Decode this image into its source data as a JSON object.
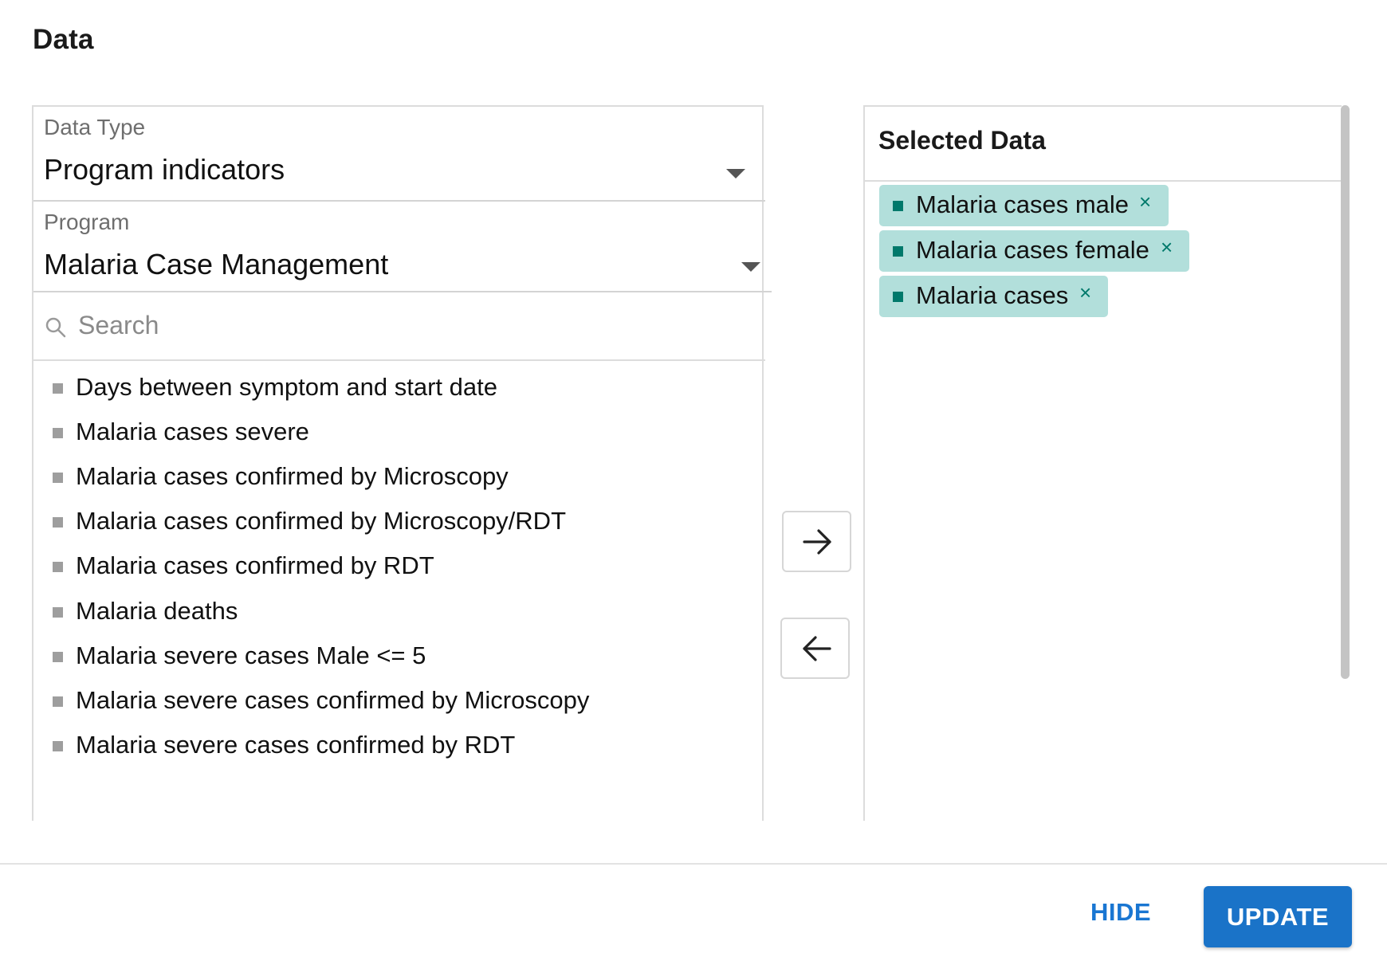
{
  "dialog": {
    "title": "Data"
  },
  "data_type": {
    "label": "Data Type",
    "value": "Program indicators"
  },
  "program": {
    "label": "Program",
    "value": "Malaria Case Management"
  },
  "search": {
    "placeholder": "Search"
  },
  "available_items": [
    "Days between symptom and start date",
    "Malaria cases severe",
    "Malaria cases confirmed by Microscopy",
    "Malaria cases confirmed by Microscopy/RDT",
    "Malaria cases confirmed by RDT",
    "Malaria deaths",
    "Malaria severe cases Male <= 5",
    "Malaria severe cases confirmed by Microscopy",
    "Malaria severe cases confirmed by RDT"
  ],
  "selected": {
    "header": "Selected Data",
    "items": [
      "Malaria cases male",
      "Malaria cases female",
      "Malaria cases"
    ],
    "remove_glyph": "×"
  },
  "actions": {
    "hide_label": "HIDE",
    "update_label": "UPDATE"
  },
  "colors": {
    "accent": "#1a73c8",
    "chip_bg": "#b2dfdb",
    "chip_dot": "#00796b"
  }
}
